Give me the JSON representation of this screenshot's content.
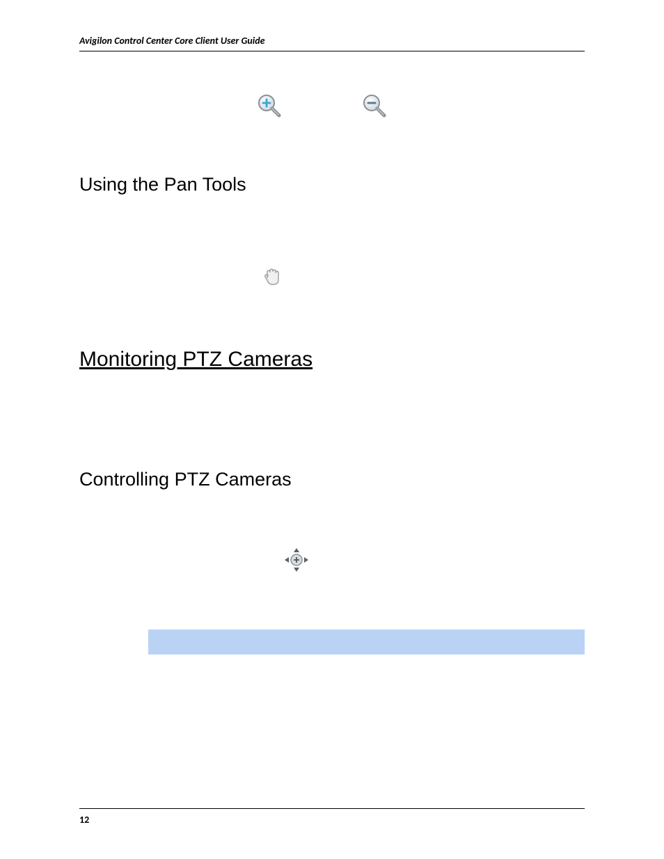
{
  "header": {
    "title": "Avigilon Control Center Core Client User Guide"
  },
  "sections": {
    "pan_tools": "Using the Pan Tools",
    "monitoring_ptz": "Monitoring PTZ Cameras",
    "controlling_ptz": "Controlling PTZ Cameras"
  },
  "icons": {
    "zoom_in": "zoom-in-icon",
    "zoom_out": "zoom-out-icon",
    "hand": "hand-icon",
    "ptz": "ptz-control-icon"
  },
  "colors": {
    "highlight_bar": "#bad3f5",
    "zoom_in_accent": "#3ba9d6",
    "zoom_out_accent": "#5f7a8c"
  },
  "footer": {
    "page_number": "12"
  }
}
